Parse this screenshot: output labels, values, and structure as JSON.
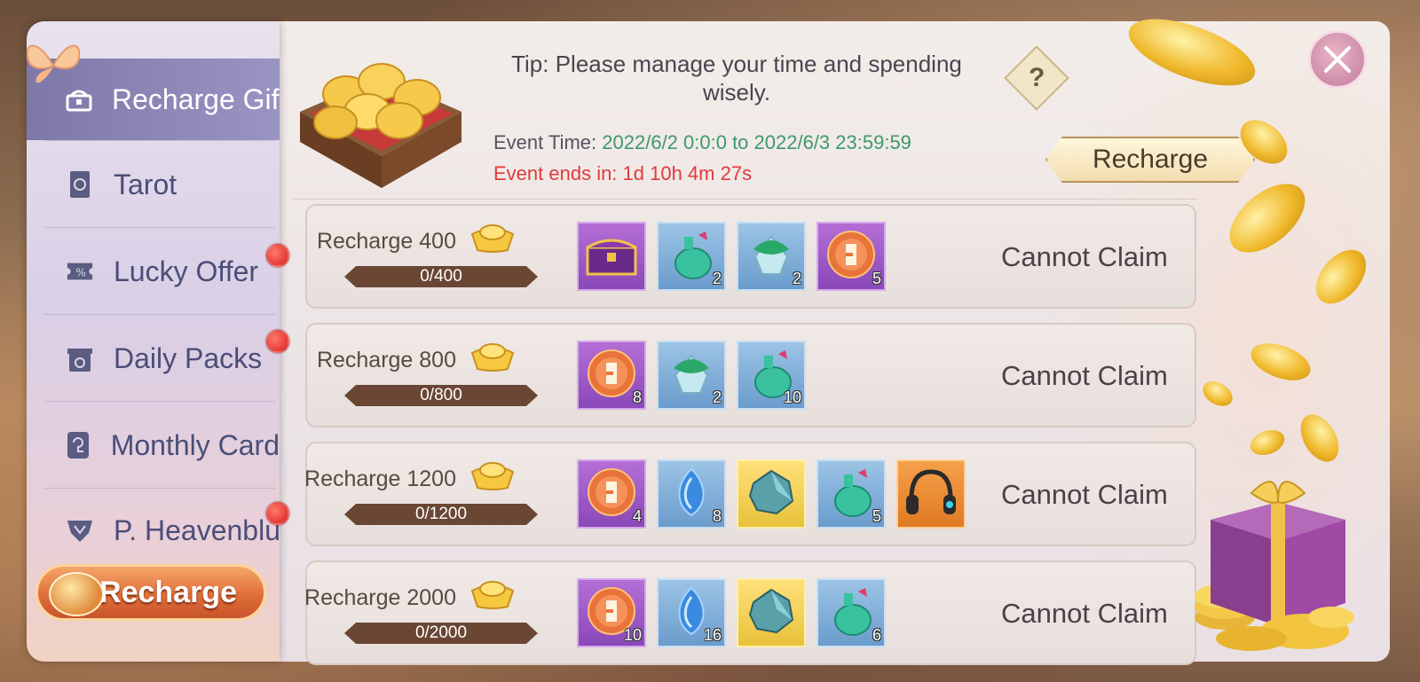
{
  "sidebar": {
    "items": [
      {
        "label": "Recharge Gift",
        "icon": "gift-chest-icon",
        "active": true,
        "dot": false
      },
      {
        "label": "Tarot",
        "icon": "tarot-card-icon",
        "active": false,
        "dot": false
      },
      {
        "label": "Lucky Offer",
        "icon": "ticket-icon",
        "active": false,
        "dot": true
      },
      {
        "label": "Daily Packs",
        "icon": "daily-pack-icon",
        "active": false,
        "dot": true
      },
      {
        "label": "Monthly Card",
        "icon": "card-icon",
        "active": false,
        "dot": false
      },
      {
        "label": "P. Heavenblue",
        "icon": "pass-icon",
        "active": false,
        "dot": true
      }
    ],
    "recharge_button": "Recharge"
  },
  "header": {
    "tip": "Tip: Please manage your time and spending wisely.",
    "event_time_label": "Event Time: ",
    "event_time_value": "2022/6/2 0:0:0 to 2022/6/3 23:59:59",
    "event_ends": "Event ends in: 1d 10h 4m 27s",
    "recharge_button": "Recharge",
    "help_symbol": "?"
  },
  "rows": [
    {
      "title": "Recharge 400",
      "progress": "0/400",
      "status": "Cannot Claim",
      "items": [
        {
          "type": "chest-icon",
          "bg": "purple",
          "qty": ""
        },
        {
          "type": "potion-icon",
          "bg": "blue",
          "qty": "2"
        },
        {
          "type": "crystal-bag-icon",
          "bg": "blue",
          "qty": "2"
        },
        {
          "type": "exp-orb-icon",
          "bg": "purple",
          "qty": "5"
        }
      ]
    },
    {
      "title": "Recharge 800",
      "progress": "0/800",
      "status": "Cannot Claim",
      "items": [
        {
          "type": "exp-orb-icon",
          "bg": "purple",
          "qty": "8"
        },
        {
          "type": "crystal-bag-icon",
          "bg": "blue",
          "qty": "2"
        },
        {
          "type": "potion-icon",
          "bg": "blue",
          "qty": "10"
        }
      ]
    },
    {
      "title": "Recharge 1200",
      "progress": "0/1200",
      "status": "Cannot Claim",
      "items": [
        {
          "type": "exp-orb-icon",
          "bg": "purple",
          "qty": "4"
        },
        {
          "type": "blue-gem-icon",
          "bg": "blue",
          "qty": "8"
        },
        {
          "type": "ore-icon",
          "bg": "gold",
          "qty": ""
        },
        {
          "type": "potion-icon",
          "bg": "blue",
          "qty": "5"
        },
        {
          "type": "headphones-icon",
          "bg": "orange",
          "qty": ""
        }
      ]
    },
    {
      "title": "Recharge 2000",
      "progress": "0/2000",
      "status": "Cannot Claim",
      "items": [
        {
          "type": "exp-orb-icon",
          "bg": "purple",
          "qty": "10"
        },
        {
          "type": "blue-gem-icon",
          "bg": "blue",
          "qty": "16"
        },
        {
          "type": "ore-icon",
          "bg": "gold",
          "qty": ""
        },
        {
          "type": "potion-icon",
          "bg": "blue",
          "qty": "6"
        }
      ]
    }
  ],
  "colors": {
    "event_time_value": "#3d9a6a",
    "event_ends": "#e23a3a",
    "active_tab": "#8f89b8",
    "progress_bar": "#6a4634"
  }
}
